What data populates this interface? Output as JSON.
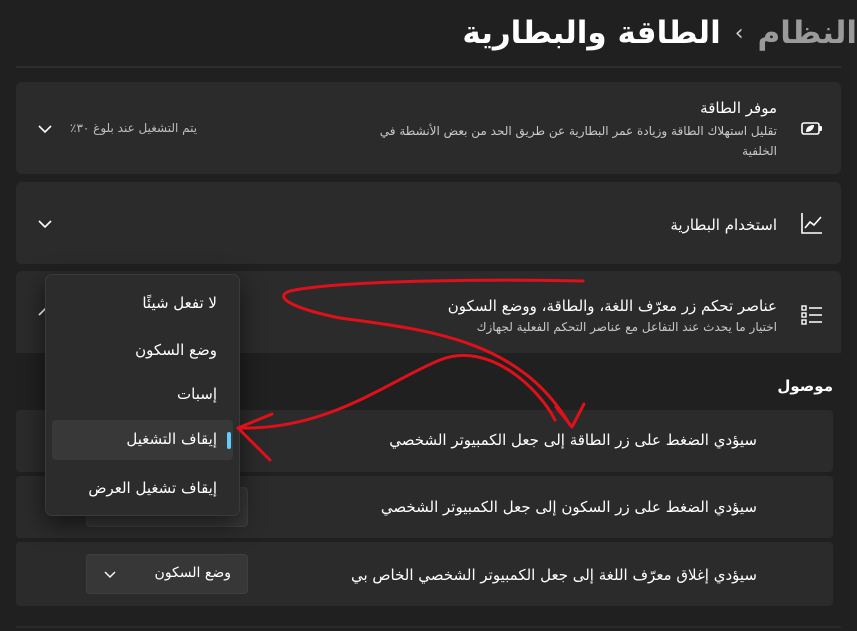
{
  "breadcrumb": {
    "parent": "النظام",
    "separator": "›",
    "current": "الطاقة والبطارية"
  },
  "energy_saver": {
    "title": "موفر الطاقة",
    "description": "تقليل استهلاك الطاقة وزيادة عمر البطارية عن طريق الحد من بعض الأنشطة في الخلفية",
    "status": "يتم التشغيل عند بلوغ ٣٠٪",
    "icon": "battery-leaf-icon"
  },
  "battery_usage": {
    "title": "استخدام البطارية",
    "icon": "chart-line-icon"
  },
  "lid_power_controls": {
    "title": "عناصر تحكم زر معرّف اللغة، والطاقة، ووضع السكون",
    "description": "اختيار ما يحدث عند التفاعل مع عناصر التحكم الفعلية لجهازك",
    "icon": "list-settings-icon",
    "section_label": "موصول",
    "rows": [
      {
        "label": "سيؤدي الضغط على زر الطاقة إلى جعل الكمبيوتر الشخصي"
      },
      {
        "label": "سيؤدي الضغط على زر السكون إلى جعل الكمبيوتر الشخصي"
      },
      {
        "label": "سيؤدي إغلاق معرّف اللغة إلى جعل الكمبيوتر الشخصي الخاص بي",
        "value": "وضع السكون"
      }
    ]
  },
  "dropdown_menu": {
    "options": [
      "لا تفعل شيئًا",
      "وضع السكون",
      "إسبات",
      "إيقاف التشغيل",
      "إيقاف تشغيل العرض"
    ],
    "selected_index": 3
  },
  "colors": {
    "accent": "#60cdff",
    "annotation": "#e0101a",
    "card": "#2b2b2b",
    "background": "#202020"
  }
}
